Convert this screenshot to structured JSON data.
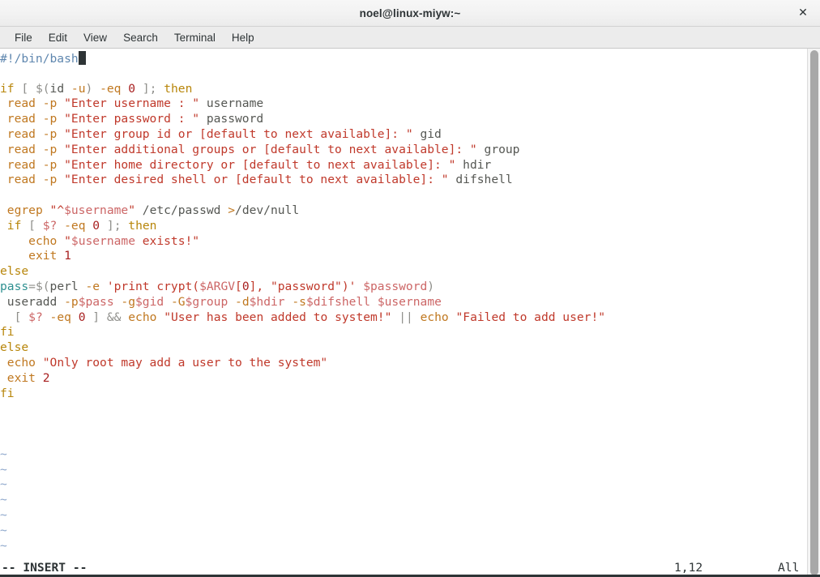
{
  "window": {
    "title": "noel@linux-miyw:~",
    "close_label": "✕"
  },
  "menubar": {
    "items": [
      {
        "label": "File"
      },
      {
        "label": "Edit"
      },
      {
        "label": "View"
      },
      {
        "label": "Search"
      },
      {
        "label": "Terminal"
      },
      {
        "label": "Help"
      }
    ]
  },
  "editor": {
    "application": "vim",
    "filetype": "bash",
    "lines": [
      {
        "tokens": [
          {
            "t": "#!/bin/bash",
            "c": "cmt"
          },
          {
            "t": "",
            "c": "cursor"
          }
        ]
      },
      {
        "tokens": []
      },
      {
        "tokens": [
          {
            "t": "if",
            "c": "kw"
          },
          {
            "t": " ",
            "c": "pln"
          },
          {
            "t": "[",
            "c": "op"
          },
          {
            "t": " ",
            "c": "pln"
          },
          {
            "t": "$(",
            "c": "op"
          },
          {
            "t": "id",
            "c": "pln"
          },
          {
            "t": " ",
            "c": "pln"
          },
          {
            "t": "-u",
            "c": "flag"
          },
          {
            "t": ")",
            "c": "op"
          },
          {
            "t": " ",
            "c": "pln"
          },
          {
            "t": "-eq",
            "c": "flag"
          },
          {
            "t": " ",
            "c": "pln"
          },
          {
            "t": "0",
            "c": "num"
          },
          {
            "t": " ",
            "c": "pln"
          },
          {
            "t": "]",
            "c": "op"
          },
          {
            "t": ";",
            "c": "op"
          },
          {
            "t": " ",
            "c": "pln"
          },
          {
            "t": "then",
            "c": "kw"
          }
        ]
      },
      {
        "tokens": [
          {
            "t": " ",
            "c": "pln"
          },
          {
            "t": "read",
            "c": "cmd"
          },
          {
            "t": " ",
            "c": "pln"
          },
          {
            "t": "-p",
            "c": "flag"
          },
          {
            "t": " ",
            "c": "pln"
          },
          {
            "t": "\"Enter username : \"",
            "c": "str"
          },
          {
            "t": " ",
            "c": "pln"
          },
          {
            "t": "username",
            "c": "pln"
          }
        ]
      },
      {
        "tokens": [
          {
            "t": " ",
            "c": "pln"
          },
          {
            "t": "read",
            "c": "cmd"
          },
          {
            "t": " ",
            "c": "pln"
          },
          {
            "t": "-p",
            "c": "flag"
          },
          {
            "t": " ",
            "c": "pln"
          },
          {
            "t": "\"Enter password : \"",
            "c": "str"
          },
          {
            "t": " ",
            "c": "pln"
          },
          {
            "t": "password",
            "c": "pln"
          }
        ]
      },
      {
        "tokens": [
          {
            "t": " ",
            "c": "pln"
          },
          {
            "t": "read",
            "c": "cmd"
          },
          {
            "t": " ",
            "c": "pln"
          },
          {
            "t": "-p",
            "c": "flag"
          },
          {
            "t": " ",
            "c": "pln"
          },
          {
            "t": "\"Enter group id or [default to next available]: \"",
            "c": "str"
          },
          {
            "t": " ",
            "c": "pln"
          },
          {
            "t": "gid",
            "c": "pln"
          }
        ]
      },
      {
        "tokens": [
          {
            "t": " ",
            "c": "pln"
          },
          {
            "t": "read",
            "c": "cmd"
          },
          {
            "t": " ",
            "c": "pln"
          },
          {
            "t": "-p",
            "c": "flag"
          },
          {
            "t": " ",
            "c": "pln"
          },
          {
            "t": "\"Enter additional groups or [default to next available]: \"",
            "c": "str"
          },
          {
            "t": " ",
            "c": "pln"
          },
          {
            "t": "group",
            "c": "pln"
          }
        ]
      },
      {
        "tokens": [
          {
            "t": " ",
            "c": "pln"
          },
          {
            "t": "read",
            "c": "cmd"
          },
          {
            "t": " ",
            "c": "pln"
          },
          {
            "t": "-p",
            "c": "flag"
          },
          {
            "t": " ",
            "c": "pln"
          },
          {
            "t": "\"Enter home directory or [default to next available]: \"",
            "c": "str"
          },
          {
            "t": " ",
            "c": "pln"
          },
          {
            "t": "hdir",
            "c": "pln"
          }
        ]
      },
      {
        "tokens": [
          {
            "t": " ",
            "c": "pln"
          },
          {
            "t": "read",
            "c": "cmd"
          },
          {
            "t": " ",
            "c": "pln"
          },
          {
            "t": "-p",
            "c": "flag"
          },
          {
            "t": " ",
            "c": "pln"
          },
          {
            "t": "\"Enter desired shell or [default to next available]: \"",
            "c": "str"
          },
          {
            "t": " ",
            "c": "pln"
          },
          {
            "t": "difshell",
            "c": "pln"
          }
        ]
      },
      {
        "tokens": []
      },
      {
        "tokens": [
          {
            "t": " ",
            "c": "pln"
          },
          {
            "t": "egrep",
            "c": "cmd"
          },
          {
            "t": " ",
            "c": "pln"
          },
          {
            "t": "\"^",
            "c": "str"
          },
          {
            "t": "$username",
            "c": "var"
          },
          {
            "t": "\"",
            "c": "str"
          },
          {
            "t": " ",
            "c": "pln"
          },
          {
            "t": "/etc/passwd",
            "c": "path"
          },
          {
            "t": " ",
            "c": "pln"
          },
          {
            "t": ">",
            "c": "flag"
          },
          {
            "t": "/dev/null",
            "c": "path"
          }
        ]
      },
      {
        "tokens": [
          {
            "t": " ",
            "c": "pln"
          },
          {
            "t": "if",
            "c": "kw"
          },
          {
            "t": " ",
            "c": "pln"
          },
          {
            "t": "[",
            "c": "op"
          },
          {
            "t": " ",
            "c": "pln"
          },
          {
            "t": "$?",
            "c": "var"
          },
          {
            "t": " ",
            "c": "pln"
          },
          {
            "t": "-eq",
            "c": "flag"
          },
          {
            "t": " ",
            "c": "pln"
          },
          {
            "t": "0",
            "c": "num"
          },
          {
            "t": " ",
            "c": "pln"
          },
          {
            "t": "]",
            "c": "op"
          },
          {
            "t": ";",
            "c": "op"
          },
          {
            "t": " ",
            "c": "pln"
          },
          {
            "t": "then",
            "c": "kw"
          }
        ]
      },
      {
        "tokens": [
          {
            "t": "    ",
            "c": "pln"
          },
          {
            "t": "echo",
            "c": "cmd"
          },
          {
            "t": " ",
            "c": "pln"
          },
          {
            "t": "\"",
            "c": "str"
          },
          {
            "t": "$username",
            "c": "var"
          },
          {
            "t": " exists!\"",
            "c": "str"
          }
        ]
      },
      {
        "tokens": [
          {
            "t": "    ",
            "c": "pln"
          },
          {
            "t": "exit",
            "c": "cmd"
          },
          {
            "t": " ",
            "c": "pln"
          },
          {
            "t": "1",
            "c": "num"
          }
        ]
      },
      {
        "tokens": [
          {
            "t": "else",
            "c": "kw"
          }
        ]
      },
      {
        "tokens": [
          {
            "t": "pass",
            "c": "asg"
          },
          {
            "t": "=",
            "c": "op"
          },
          {
            "t": "$(",
            "c": "op"
          },
          {
            "t": "perl",
            "c": "pln"
          },
          {
            "t": " ",
            "c": "pln"
          },
          {
            "t": "-e",
            "c": "flag"
          },
          {
            "t": " ",
            "c": "pln"
          },
          {
            "t": "'print crypt(",
            "c": "str"
          },
          {
            "t": "$ARGV",
            "c": "var"
          },
          {
            "t": "[",
            "c": "str"
          },
          {
            "t": "0",
            "c": "num"
          },
          {
            "t": "], \"password\")'",
            "c": "str"
          },
          {
            "t": " ",
            "c": "pln"
          },
          {
            "t": "$password",
            "c": "var"
          },
          {
            "t": ")",
            "c": "op"
          }
        ]
      },
      {
        "tokens": [
          {
            "t": " ",
            "c": "pln"
          },
          {
            "t": "useradd",
            "c": "pln"
          },
          {
            "t": " ",
            "c": "pln"
          },
          {
            "t": "-p",
            "c": "flag"
          },
          {
            "t": "$pass",
            "c": "var"
          },
          {
            "t": " ",
            "c": "pln"
          },
          {
            "t": "-g",
            "c": "flag"
          },
          {
            "t": "$gid",
            "c": "var"
          },
          {
            "t": " ",
            "c": "pln"
          },
          {
            "t": "-G",
            "c": "flag"
          },
          {
            "t": "$group",
            "c": "var"
          },
          {
            "t": " ",
            "c": "pln"
          },
          {
            "t": "-d",
            "c": "flag"
          },
          {
            "t": "$hdir",
            "c": "var"
          },
          {
            "t": " ",
            "c": "pln"
          },
          {
            "t": "-s",
            "c": "flag"
          },
          {
            "t": "$difshell",
            "c": "var"
          },
          {
            "t": " ",
            "c": "pln"
          },
          {
            "t": "$username",
            "c": "var"
          }
        ]
      },
      {
        "tokens": [
          {
            "t": "  ",
            "c": "pln"
          },
          {
            "t": "[",
            "c": "op"
          },
          {
            "t": " ",
            "c": "pln"
          },
          {
            "t": "$?",
            "c": "var"
          },
          {
            "t": " ",
            "c": "pln"
          },
          {
            "t": "-eq",
            "c": "flag"
          },
          {
            "t": " ",
            "c": "pln"
          },
          {
            "t": "0",
            "c": "num"
          },
          {
            "t": " ",
            "c": "pln"
          },
          {
            "t": "]",
            "c": "op"
          },
          {
            "t": " ",
            "c": "pln"
          },
          {
            "t": "&&",
            "c": "op"
          },
          {
            "t": " ",
            "c": "pln"
          },
          {
            "t": "echo",
            "c": "cmd"
          },
          {
            "t": " ",
            "c": "pln"
          },
          {
            "t": "\"User has been added to system!\"",
            "c": "str"
          },
          {
            "t": " ",
            "c": "pln"
          },
          {
            "t": "||",
            "c": "op"
          },
          {
            "t": " ",
            "c": "pln"
          },
          {
            "t": "echo",
            "c": "cmd"
          },
          {
            "t": " ",
            "c": "pln"
          },
          {
            "t": "\"Failed to add user!\"",
            "c": "str"
          }
        ]
      },
      {
        "tokens": [
          {
            "t": "fi",
            "c": "kw"
          }
        ]
      },
      {
        "tokens": [
          {
            "t": "else",
            "c": "kw"
          }
        ]
      },
      {
        "tokens": [
          {
            "t": " ",
            "c": "pln"
          },
          {
            "t": "echo",
            "c": "cmd"
          },
          {
            "t": " ",
            "c": "pln"
          },
          {
            "t": "\"Only root may add a user to the system\"",
            "c": "str"
          }
        ]
      },
      {
        "tokens": [
          {
            "t": " ",
            "c": "pln"
          },
          {
            "t": "exit",
            "c": "cmd"
          },
          {
            "t": " ",
            "c": "pln"
          },
          {
            "t": "2",
            "c": "num"
          }
        ]
      },
      {
        "tokens": [
          {
            "t": "fi",
            "c": "kw"
          }
        ]
      },
      {
        "tokens": []
      },
      {
        "tokens": []
      },
      {
        "tokens": []
      },
      {
        "tokens": [
          {
            "t": "~",
            "c": "tilde"
          }
        ]
      },
      {
        "tokens": [
          {
            "t": "~",
            "c": "tilde"
          }
        ]
      },
      {
        "tokens": [
          {
            "t": "~",
            "c": "tilde"
          }
        ]
      },
      {
        "tokens": [
          {
            "t": "~",
            "c": "tilde"
          }
        ]
      },
      {
        "tokens": [
          {
            "t": "~",
            "c": "tilde"
          }
        ]
      },
      {
        "tokens": [
          {
            "t": "~",
            "c": "tilde"
          }
        ]
      },
      {
        "tokens": [
          {
            "t": "~",
            "c": "tilde"
          }
        ]
      },
      {
        "tokens": [
          {
            "t": "~",
            "c": "tilde"
          }
        ]
      }
    ]
  },
  "statusline": {
    "mode": "-- INSERT --",
    "position": "1,12",
    "scroll": "All"
  },
  "colors": {
    "keyword": "#b8860b",
    "command": "#c07820",
    "string": "#c0392b",
    "variable": "#cc6666",
    "number": "#a82020",
    "plain": "#555753",
    "operator": "#8f8f8b",
    "assignment": "#2e9090",
    "comment": "#5f87af",
    "tilde": "#8fa8cc",
    "titlebar_bg": "#f2f2f2",
    "menubar_bg": "#ececec",
    "terminal_bg": "#ffffff",
    "scrollbar_thumb": "#a8a8a8"
  }
}
